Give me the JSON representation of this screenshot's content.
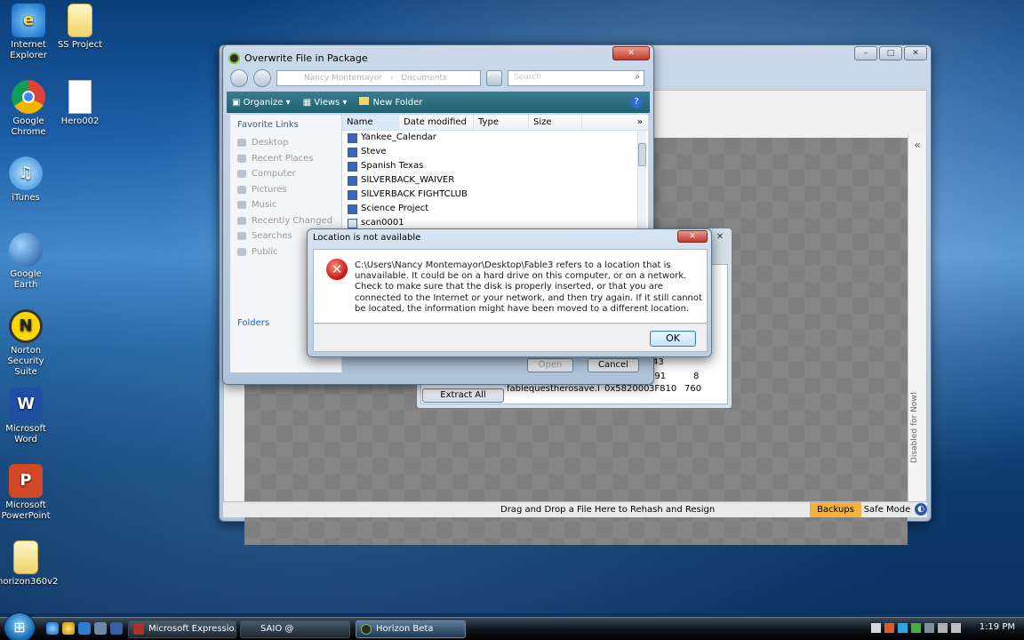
{
  "desktop": {
    "icons": [
      {
        "label": "Internet Explorer",
        "icon": "internet-explorer-icon"
      },
      {
        "label": "SS Project",
        "icon": "folder-icon"
      },
      {
        "label": "Google Chrome",
        "icon": "chrome-icon"
      },
      {
        "label": "Hero002",
        "icon": "file-icon"
      },
      {
        "label": "iTunes",
        "icon": "itunes-icon"
      },
      {
        "label": "Google Earth",
        "icon": "google-earth-icon"
      },
      {
        "label": "Norton Security Suite",
        "icon": "norton-icon"
      },
      {
        "label": "Microsoft Word",
        "icon": "word-icon"
      },
      {
        "label": "Microsoft PowerPoint",
        "icon": "powerpoint-icon"
      },
      {
        "label": "horizon360v2",
        "icon": "folder-icon"
      }
    ]
  },
  "horizon": {
    "status_text": "Drag and Drop a File Here to Rehash and Resign",
    "backups_label": "Backups",
    "safe_mode_label": "Safe Mode",
    "side_text": "Disabled for Now!",
    "collapse_glyph": "«",
    "accent_color": "#f4b13f"
  },
  "package": {
    "extract_all_label": "Extract All",
    "rows": [
      {
        "name": "",
        "offset": "",
        "size": "791",
        "blocks": "8"
      },
      {
        "name": "fablequestherosave.bin",
        "offset": "0x582000",
        "size": "3F810",
        "blocks": "760"
      }
    ],
    "number_43": "43"
  },
  "save_dialog": {
    "title": "Overwrite File in Package",
    "address_crumbs": [
      "Nancy Montemayor",
      "Documents"
    ],
    "search_placeholder": "Search",
    "toolbar": {
      "organize": "Organize",
      "views": "Views",
      "new_folder": "New Folder"
    },
    "favorite_links_label": "Favorite Links",
    "favorites": [
      "Desktop",
      "Recent Places",
      "Computer",
      "Pictures",
      "Music",
      "Recently Changed",
      "Searches",
      "Public"
    ],
    "folders_label": "Folders",
    "columns": [
      "Name",
      "Date modified",
      "Type",
      "Size"
    ],
    "more_columns": "»",
    "files": [
      {
        "name": "Yankee_Calendar",
        "kind": "doc"
      },
      {
        "name": "Steve",
        "kind": "doc"
      },
      {
        "name": "Spanish Texas",
        "kind": "doc"
      },
      {
        "name": "SILVERBACK_WAIVER",
        "kind": "doc"
      },
      {
        "name": "SILVERBACK FIGHTCLUB",
        "kind": "doc"
      },
      {
        "name": "Science Project",
        "kind": "doc"
      },
      {
        "name": "scan0001",
        "kind": "image"
      }
    ],
    "open_label": "Open",
    "cancel_label": "Cancel"
  },
  "error_dialog": {
    "title": "Location is not available",
    "message": "C:\\Users\\Nancy Montemayor\\Desktop\\Fable3 refers to a location that is unavailable. It could be on a hard drive on this computer, or on a network. Check to make sure that the disk is properly inserted, or that you are connected to the Internet or your network, and then try again. If it still cannot be located, the information might have been moved to a different location.",
    "ok_label": "OK",
    "icon": "error-icon"
  },
  "taskbar": {
    "buttons": [
      {
        "label": "Microsoft Expressio...",
        "icon": "expression-icon"
      },
      {
        "label": "SAIO @",
        "icon": "saio-icon"
      },
      {
        "label": "Horizon Beta",
        "icon": "horizon-icon"
      }
    ],
    "clock": "1:19 PM"
  }
}
